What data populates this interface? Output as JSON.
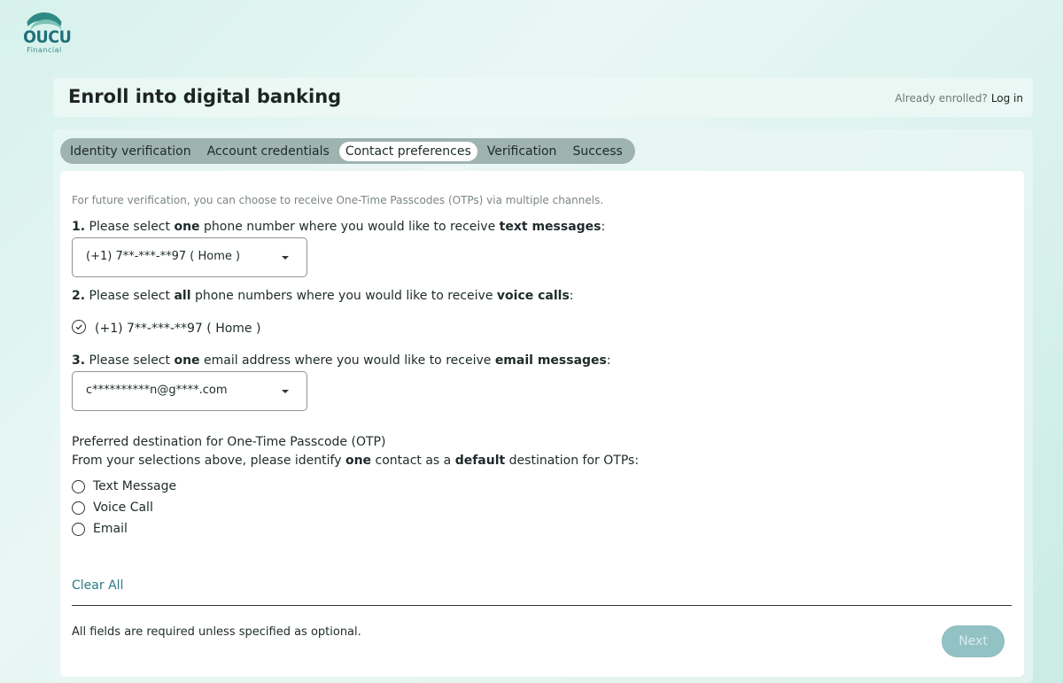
{
  "brand": {
    "name": "OUCU",
    "subtitle": "Financial"
  },
  "header": {
    "title": "Enroll into digital banking",
    "enrolled_text": "Already enrolled?",
    "login_link": "Log in"
  },
  "tabs": [
    {
      "label": "Identity verification",
      "active": false
    },
    {
      "label": "Account credentials",
      "active": false
    },
    {
      "label": "Contact preferences",
      "active": true
    },
    {
      "label": "Verification",
      "active": false
    },
    {
      "label": "Success",
      "active": false
    }
  ],
  "form": {
    "intro": "For future verification, you can choose to receive One-Time Passcodes (OTPs) via multiple channels.",
    "q1": {
      "num": "1.",
      "pre": " Please select ",
      "bold": "one",
      "mid": " phone number where you would like to receive ",
      "bold2": "text messages",
      "post": ":"
    },
    "text_select_value": "(+1) 7**-***-**97 ( Home )",
    "q2": {
      "num": "2.",
      "pre": " Please select ",
      "bold": "all",
      "mid": " phone numbers where you would like to receive ",
      "bold2": "voice calls",
      "post": ":"
    },
    "voice_option": "(+1) 7**-***-**97 ( Home )",
    "q3": {
      "num": "3.",
      "pre": " Please select ",
      "bold": "one",
      "mid": " email address where you would like to receive ",
      "bold2": "email messages",
      "post": ":"
    },
    "email_select_value": "c**********n@g****.com",
    "otp_title": "Preferred destination for One-Time Passcode (OTP)",
    "otp_sub": {
      "pre": "From your selections above, please identify ",
      "bold": "one",
      "mid": " contact as a ",
      "bold2": "default",
      "post": " destination for OTPs:"
    },
    "otp_options": [
      "Text Message",
      "Voice Call",
      "Email"
    ],
    "clear_all": "Clear All",
    "footer_note": "All fields are required unless specified as optional.",
    "next_label": "Next"
  },
  "colors": {
    "accent": "#2b7a85",
    "next_button": "#93c2c5",
    "tab_bar": "#9fb3af"
  }
}
